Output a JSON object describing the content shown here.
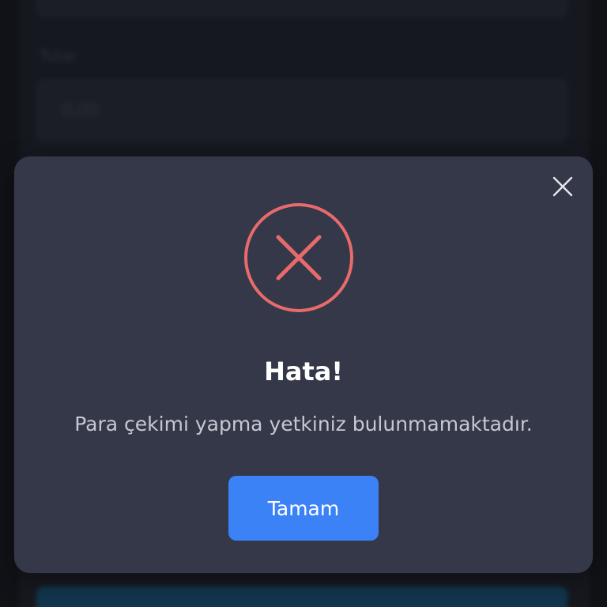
{
  "background": {
    "field_label": "Tutar",
    "field_value": "0,00"
  },
  "modal": {
    "title": "Hata!",
    "message": "Para çekimi yapma yetkiniz bulunmamaktadır.",
    "ok_label": "Tamam",
    "icon": "error-x-circle-icon",
    "close_icon": "close-icon"
  },
  "colors": {
    "modal_bg": "#353849",
    "error_accent": "#e86b6b",
    "button_bg": "#3b82f6",
    "backdrop": "#15161c"
  }
}
